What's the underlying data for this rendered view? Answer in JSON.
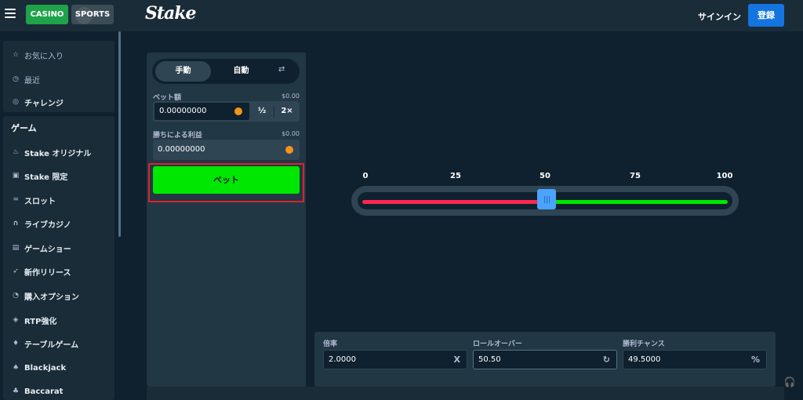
{
  "header": {
    "casino_label": "CASINO",
    "sports_label": "SPORTS",
    "logo": "Stake",
    "signin_label": "サインイン",
    "register_label": "登録"
  },
  "sidebar": {
    "top_items": [
      {
        "label": "お気に入り",
        "icon": "star-icon"
      },
      {
        "label": "最近",
        "icon": "clock-icon"
      },
      {
        "label": "チャレンジ",
        "icon": "target-icon"
      }
    ],
    "games_heading": "ゲーム",
    "game_items": [
      {
        "label": "Stake オリジナル",
        "icon": "fire-icon"
      },
      {
        "label": "Stake 限定",
        "icon": "bookmark-icon"
      },
      {
        "label": "スロット",
        "icon": "slots-icon"
      },
      {
        "label": "ライブカジノ",
        "icon": "headset-icon"
      },
      {
        "label": "ゲームショー",
        "icon": "gift-icon"
      },
      {
        "label": "新作リリース",
        "icon": "rocket-icon"
      },
      {
        "label": "購入オプション",
        "icon": "coin-icon"
      },
      {
        "label": "RTP強化",
        "icon": "tag-icon"
      },
      {
        "label": "テーブルゲーム",
        "icon": "chip-icon"
      },
      {
        "label": "Blackjack",
        "icon": "spade-icon"
      },
      {
        "label": "Baccarat",
        "icon": "cards-icon"
      }
    ]
  },
  "game": {
    "tabs": {
      "manual": "手動",
      "auto": "自動",
      "swap_icon": "swap-icon"
    },
    "bet_amount": {
      "label": "ベット額",
      "usd": "$0.00",
      "value": "0.00000000",
      "half": "½",
      "double": "2×"
    },
    "profit": {
      "label": "勝ちによる利益",
      "usd": "$0.00",
      "value": "0.00000000"
    },
    "bet_button": "ベット",
    "slider": {
      "ticks": [
        "0",
        "25",
        "50",
        "75",
        "100"
      ],
      "value": 50.5
    },
    "stats": {
      "multiplier": {
        "label": "倍率",
        "value": "2.0000",
        "suffix": "X"
      },
      "roll_over": {
        "label": "ロールオーバー",
        "value": "50.50",
        "suffix": "↻"
      },
      "win_chance": {
        "label": "勝利チャンス",
        "value": "49.5000",
        "suffix": "%"
      }
    }
  },
  "colors": {
    "accent_green": "#00e701",
    "lose_red": "#ff264e",
    "handle_blue": "#4aa3ff",
    "register_blue": "#1475e1"
  }
}
